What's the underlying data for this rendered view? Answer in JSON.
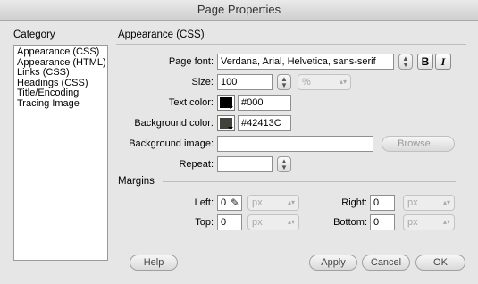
{
  "window": {
    "title": "Page Properties"
  },
  "category": {
    "title": "Category",
    "items": [
      "Appearance (CSS)",
      "Appearance (HTML)",
      "Links (CSS)",
      "Headings (CSS)",
      "Title/Encoding",
      "Tracing Image"
    ]
  },
  "section": {
    "title": "Appearance (CSS)"
  },
  "fields": {
    "page_font_label": "Page font:",
    "page_font_value": "Verdana, Arial, Helvetica, sans-serif",
    "bold_label": "B",
    "italic_label": "I",
    "size_label": "Size:",
    "size_value": "100",
    "size_unit": "%",
    "text_color_label": "Text color:",
    "text_color_value": "#000",
    "text_color_swatch": "#000000",
    "bg_color_label": "Background color:",
    "bg_color_value": "#42413C",
    "bg_color_swatch": "#42413C",
    "bg_image_label": "Background image:",
    "bg_image_value": "",
    "browse_label": "Browse...",
    "repeat_label": "Repeat:",
    "repeat_value": ""
  },
  "margins": {
    "title": "Margins",
    "left_label": "Left:",
    "left_value": "0",
    "left_unit": "px",
    "top_label": "Top:",
    "top_value": "0",
    "top_unit": "px",
    "right_label": "Right:",
    "right_value": "0",
    "right_unit": "px",
    "bottom_label": "Bottom:",
    "bottom_value": "0",
    "bottom_unit": "px"
  },
  "buttons": {
    "help": "Help",
    "apply": "Apply",
    "cancel": "Cancel",
    "ok": "OK"
  }
}
